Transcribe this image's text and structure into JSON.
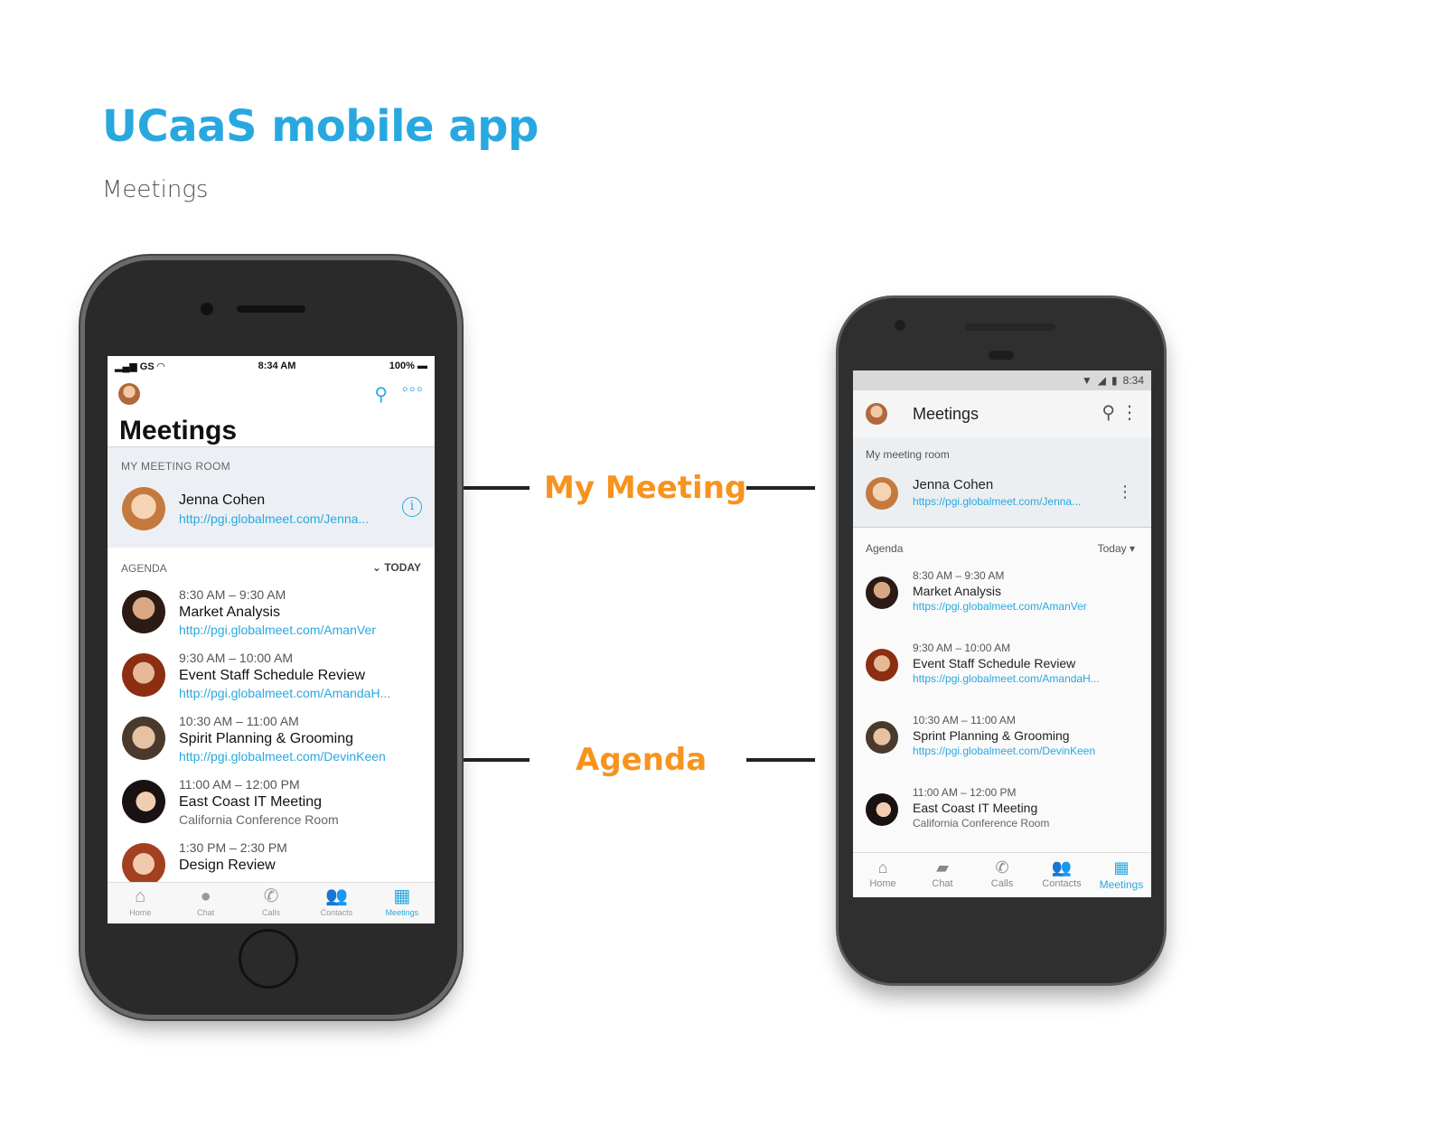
{
  "page": {
    "title": "UCaaS mobile app",
    "subtitle": "Meetings"
  },
  "callouts": {
    "my_meeting": "My Meeting",
    "agenda": "Agenda"
  },
  "colors": {
    "accent": "#29a8e0",
    "callout": "#f7931e"
  },
  "ios": {
    "status": {
      "carrier": "GS",
      "time": "8:34 AM",
      "battery": "100%"
    },
    "header": {
      "title": "Meetings",
      "search_icon": "search-icon",
      "more_icon": "more-icon"
    },
    "room": {
      "label": "MY MEETING ROOM",
      "name": "Jenna Cohen",
      "link": "http://pgi.globalmeet.com/Jenna..."
    },
    "agenda": {
      "label": "AGENDA",
      "filter": "TODAY"
    },
    "items": [
      {
        "time": "8:30 AM – 9:30 AM",
        "name": "Market Analysis",
        "detail": "http://pgi.globalmeet.com/AmanVer"
      },
      {
        "time": "9:30 AM – 10:00 AM",
        "name": "Event Staff Schedule Review",
        "detail": "http://pgi.globalmeet.com/AmandaH..."
      },
      {
        "time": "10:30 AM – 11:00 AM",
        "name": "Spirit Planning & Grooming",
        "detail": "http://pgi.globalmeet.com/DevinKeen"
      },
      {
        "time": "11:00 AM – 12:00 PM",
        "name": "East Coast IT Meeting",
        "detail": "California Conference Room"
      },
      {
        "time": "1:30 PM – 2:30 PM",
        "name": "Design Review",
        "detail": ""
      }
    ],
    "tabs": [
      "Home",
      "Chat",
      "Calls",
      "Contacts",
      "Meetings"
    ]
  },
  "android": {
    "status": {
      "time": "8:34"
    },
    "header": {
      "title": "Meetings"
    },
    "room": {
      "label": "My meeting room",
      "name": "Jenna Cohen",
      "link": "https://pgi.globalmeet.com/Jenna..."
    },
    "agenda": {
      "label": "Agenda",
      "filter": "Today"
    },
    "items": [
      {
        "time": "8:30 AM – 9:30 AM",
        "name": "Market Analysis",
        "detail": "https://pgi.globalmeet.com/AmanVer"
      },
      {
        "time": "9:30 AM – 10:00 AM",
        "name": "Event Staff Schedule Review",
        "detail": "https://pgi.globalmeet.com/AmandaH..."
      },
      {
        "time": "10:30 AM – 11:00 AM",
        "name": "Sprint Planning & Grooming",
        "detail": "https://pgi.globalmeet.com/DevinKeen"
      },
      {
        "time": "11:00 AM – 12:00 PM",
        "name": "East Coast IT Meeting",
        "detail": "California Conference Room"
      }
    ],
    "tabs": [
      "Home",
      "Chat",
      "Calls",
      "Contacts",
      "Meetings"
    ]
  }
}
